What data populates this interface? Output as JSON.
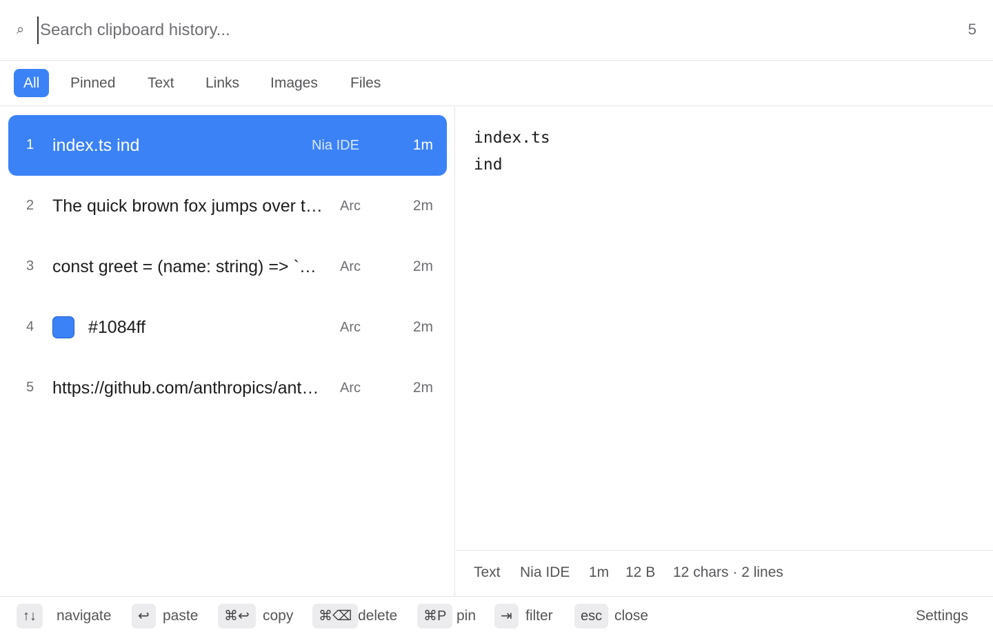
{
  "search": {
    "icon": "search-icon",
    "placeholder": "Search clipboard history...",
    "value": "",
    "result_count": "5"
  },
  "tabs": [
    {
      "label": "All",
      "active": true
    },
    {
      "label": "Pinned",
      "active": false
    },
    {
      "label": "Text",
      "active": false
    },
    {
      "label": "Links",
      "active": false
    },
    {
      "label": "Images",
      "active": false
    },
    {
      "label": "Files",
      "active": false
    }
  ],
  "items": [
    {
      "index": "1",
      "text": "index.ts ind",
      "app": "Nia IDE",
      "time": "1m",
      "selected": true
    },
    {
      "index": "2",
      "text": "The quick brown fox jumps over the lazy dog",
      "app": "Arc",
      "time": "2m"
    },
    {
      "index": "3",
      "text": "const greet = (name: string) => `Hello, ${name}`",
      "app": "Arc",
      "time": "2m"
    },
    {
      "index": "4",
      "text": "#1084ff",
      "app": "Arc",
      "time": "2m",
      "swatch_color": "#3b82f6"
    },
    {
      "index": "5",
      "text": "https://github.com/anthropics/anthropic-sdk",
      "app": "Arc",
      "time": "2m"
    }
  ],
  "preview": {
    "content": "index.ts\nind",
    "meta": {
      "type": "Text",
      "app": "Nia IDE",
      "time": "1m",
      "size": "12 B",
      "stats": "12 chars · 2 lines"
    }
  },
  "footer": {
    "hints": [
      {
        "key": "↑↓",
        "label": "navigate"
      },
      {
        "key": "↩",
        "label": "paste"
      },
      {
        "key": "⌘↩",
        "label": "copy"
      },
      {
        "key": "⌘⌫",
        "label": "delete"
      },
      {
        "key": "⌘P",
        "label": "pin"
      },
      {
        "key": "⇥",
        "label": "filter"
      },
      {
        "key": "esc",
        "label": "close"
      }
    ],
    "settings_label": "Settings"
  },
  "colors": {
    "accent": "#3b82f6",
    "text_primary": "#1d1d1f",
    "text_secondary": "#6e6e73"
  }
}
